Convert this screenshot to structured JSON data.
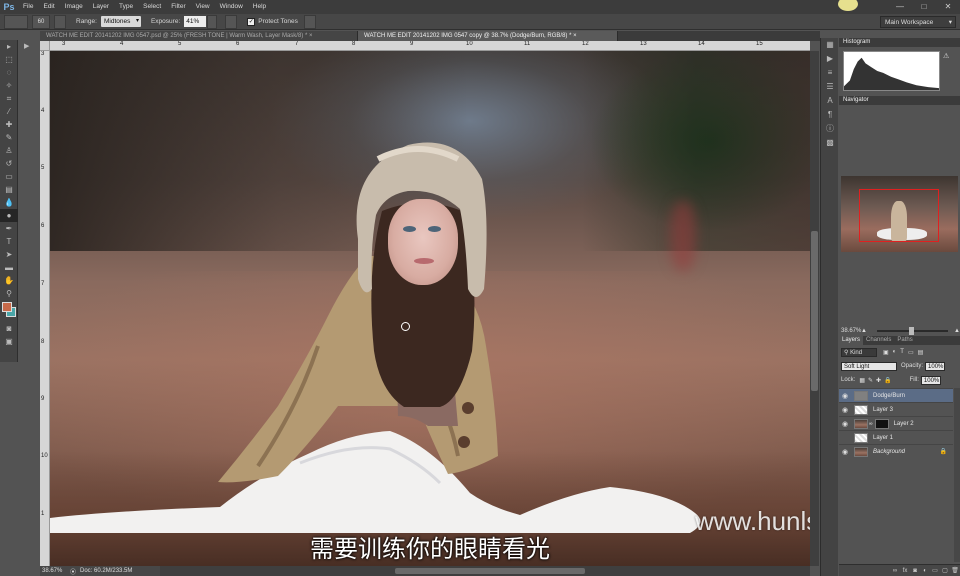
{
  "app": {
    "logo": "Ps"
  },
  "menu": [
    "File",
    "Edit",
    "Image",
    "Layer",
    "Type",
    "Select",
    "Filter",
    "View",
    "Window",
    "Help"
  ],
  "window_controls": [
    "—",
    "□",
    "✕"
  ],
  "options_bar": {
    "brush_size": "60",
    "range_label": "Range:",
    "range_value": "Midtones",
    "exposure_label": "Exposure:",
    "exposure_value": "41%",
    "protect_tones_label": "Protect Tones",
    "protect_tones_checked": true,
    "workspace": "Main Workspace"
  },
  "document_tabs": [
    {
      "title": "WATCH ME EDIT 20141202 IMG 0547.psd @ 25% (FRESH TONE | Warm Wash, Layer Mask/8) *",
      "close": "×",
      "active": false
    },
    {
      "title": "WATCH ME EDIT 20141202 IMG 0547 copy @ 38.7% (Dodge/Burn, RGB/8) *",
      "close": "×",
      "active": true
    }
  ],
  "ruler_top": [
    "3",
    "4",
    "5",
    "6",
    "7",
    "8",
    "9",
    "10",
    "11",
    "12",
    "13",
    "14",
    "15"
  ],
  "ruler_left": [
    "3",
    "4",
    "5",
    "6",
    "7",
    "8",
    "9",
    "10",
    "1"
  ],
  "canvas": {
    "subtitle": "需要训练你的眼睛看光",
    "watermark": "www.hunls.com"
  },
  "status": {
    "zoom": "38.67%",
    "doc": "Doc: 60.2M/233.5M"
  },
  "histogram": {
    "tab": "Histogram",
    "warning": "⚠"
  },
  "navigator": {
    "tab": "Navigator",
    "zoom": "38.67%"
  },
  "layers": {
    "tabs": [
      "Layers",
      "Channels",
      "Paths"
    ],
    "filter_kind": "Kind",
    "blend_mode": "Soft Light",
    "opacity_label": "Opacity:",
    "opacity_value": "100%",
    "lock_label": "Lock:",
    "fill_label": "Fill:",
    "fill_value": "100%",
    "items": [
      {
        "name": "Dodge/Burn",
        "visible": true,
        "selected": true
      },
      {
        "name": "Layer 3",
        "visible": true,
        "selected": false
      },
      {
        "name": "Layer 2",
        "visible": true,
        "selected": false
      },
      {
        "name": "Layer 1",
        "visible": false,
        "selected": false
      },
      {
        "name": "Background",
        "visible": true,
        "selected": false
      }
    ]
  },
  "colors": {
    "foreground": "#c86a4a",
    "background": "#4aa6a8",
    "selected_layer": "#5b6c86"
  }
}
